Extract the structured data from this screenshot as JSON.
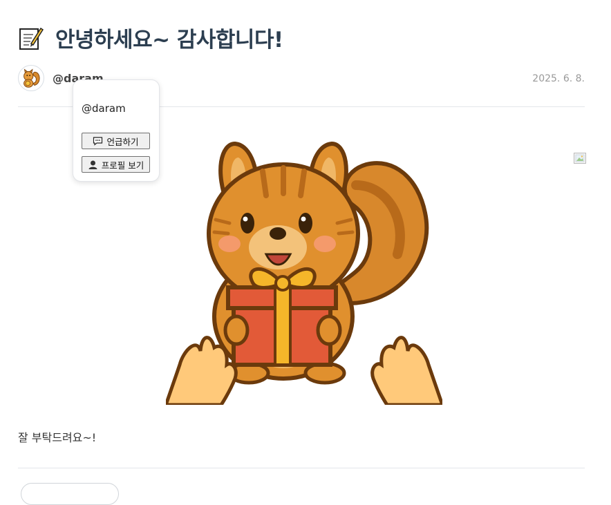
{
  "post": {
    "title": "안녕하세요~ 감사합니다!",
    "title_icon": "memo-icon",
    "author": "@daram",
    "date": "2025. 6. 8.",
    "body": "잘 부탁드려요~!"
  },
  "popup": {
    "username": "@daram",
    "mention_label": "언급하기",
    "profile_label": "프로필 보기"
  },
  "colors": {
    "title": "#2c3e50",
    "date": "#999999",
    "divider": "#e3e6ea",
    "squirrel_body": "#e0902e",
    "gift_box": "#e25a38",
    "ribbon": "#f5b62a"
  }
}
